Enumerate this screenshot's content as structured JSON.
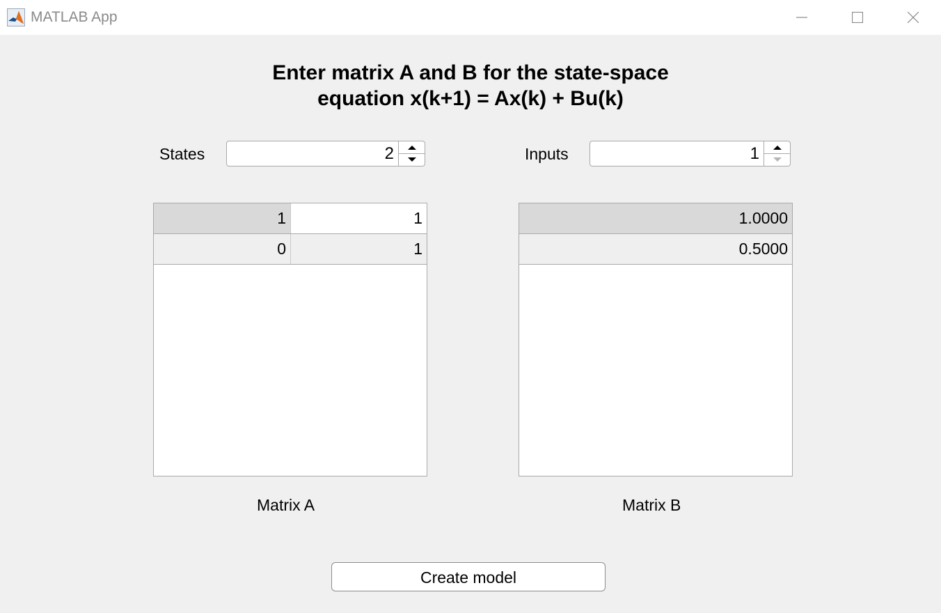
{
  "window": {
    "title": "MATLAB App",
    "icon": "matlab-logo-icon",
    "controls": [
      "minimize-icon",
      "maximize-icon",
      "close-icon"
    ]
  },
  "heading": {
    "line1": "Enter matrix A and B for the state-space",
    "line2": "equation x(k+1) = Ax(k) + Bu(k)"
  },
  "states": {
    "label": "States",
    "value": "2"
  },
  "inputs": {
    "label": "Inputs",
    "value": "1"
  },
  "matrixA": {
    "label": "Matrix A",
    "rows": [
      [
        "1",
        "1"
      ],
      [
        "0",
        "1"
      ]
    ]
  },
  "matrixB": {
    "label": "Matrix B",
    "rows": [
      [
        "1.0000"
      ],
      [
        "0.5000"
      ]
    ]
  },
  "create_button": {
    "label": "Create model"
  },
  "colors": {
    "background": "#f0f0f0",
    "selected_row": "#d9d9d9",
    "alt_row": "#efefef",
    "border": "#a9a9a9"
  }
}
